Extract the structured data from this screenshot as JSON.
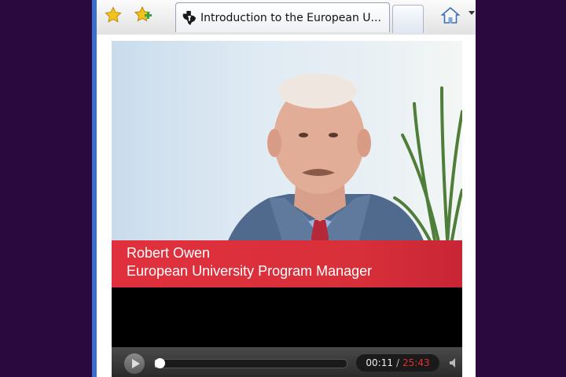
{
  "browser": {
    "tab_title": "Introduction to the European U...",
    "icons": {
      "favorites": "star-icon",
      "add_favorite": "add-star-icon",
      "site_favicon": "texas-instruments-logo-icon",
      "new_tab": "new-tab-button",
      "home": "home-icon",
      "home_menu": "dropdown-arrow-icon"
    }
  },
  "video": {
    "caption_name": "Robert Owen",
    "caption_role": "European University Program Manager",
    "current_time": "00:11",
    "time_separator": "/",
    "duration": "25:43",
    "progress_fraction": 0.007
  },
  "colors": {
    "frame_background": "#2a0a3e",
    "caption_bar": "#e0303e",
    "duration_text": "#e03030"
  }
}
